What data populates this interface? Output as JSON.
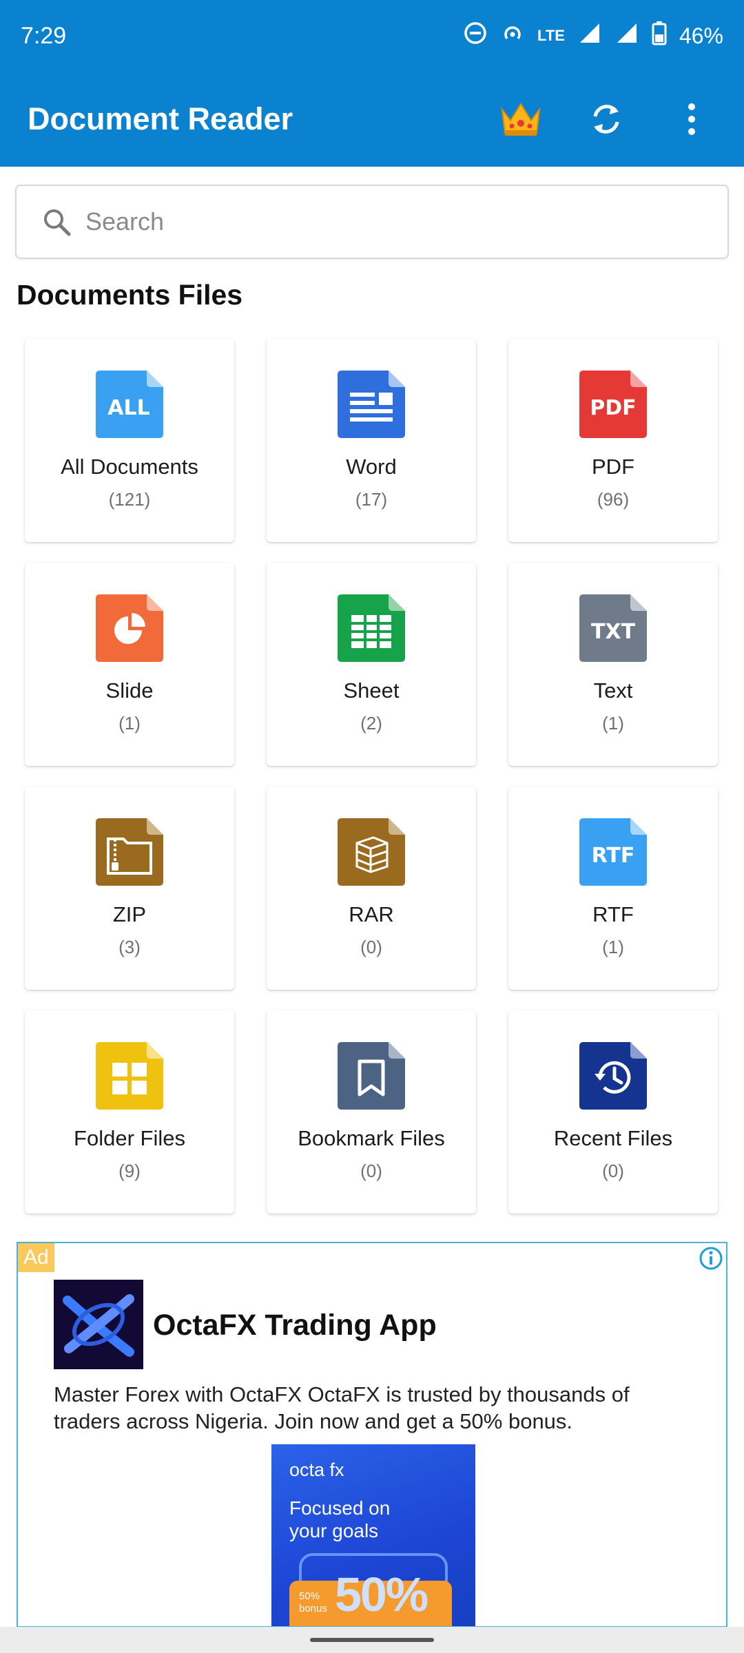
{
  "status_bar": {
    "time": "7:29",
    "network": "LTE",
    "battery": "46%"
  },
  "app_bar": {
    "title": "Document Reader",
    "icons": [
      "crown-icon",
      "sync-icon",
      "more-vertical-icon"
    ]
  },
  "search": {
    "placeholder": "Search"
  },
  "section": {
    "title": "Documents Files"
  },
  "tiles": [
    {
      "label": "All Documents",
      "count": "(121)",
      "icon_text": "ALL",
      "color": "#3aa1f2"
    },
    {
      "label": "Word",
      "count": "(17)",
      "icon": "document-lines-icon",
      "color": "#2f6fdd"
    },
    {
      "label": "PDF",
      "count": "(96)",
      "icon_text": "PDF",
      "color": "#e53935"
    },
    {
      "label": "Slide",
      "count": "(1)",
      "icon": "pie-chart-icon",
      "color": "#f26a39"
    },
    {
      "label": "Sheet",
      "count": "(2)",
      "icon": "table-grid-icon",
      "color": "#16a34a"
    },
    {
      "label": "Text",
      "count": "(1)",
      "icon_text": "TXT",
      "color": "#6f7a8a"
    },
    {
      "label": "ZIP",
      "count": "(3)",
      "icon": "zip-icon",
      "color": "#9a6b1f"
    },
    {
      "label": "RAR",
      "count": "(0)",
      "icon": "archive-box-icon",
      "color": "#9a6b1f"
    },
    {
      "label": "RTF",
      "count": "(1)",
      "icon_text": "RTF",
      "color": "#3aa1f2"
    },
    {
      "label": "Folder Files",
      "count": "(9)",
      "icon": "four-squares-icon",
      "color": "#efc20f"
    },
    {
      "label": "Bookmark Files",
      "count": "(0)",
      "icon": "bookmark-icon",
      "color": "#4d6384"
    },
    {
      "label": "Recent Files",
      "count": "(0)",
      "icon": "history-icon",
      "color": "#15348f"
    }
  ],
  "ad": {
    "badge": "Ad",
    "app_name": "OctaFX Trading App",
    "description": "Master Forex with OctaFX OctaFX is trusted by thousands of traders across Nigeria. Join now and get a 50% bonus.",
    "banner_brand": "octa fx",
    "banner_tagline": "Focused on your goals",
    "banner_bonus_label": "50% bonus",
    "banner_big": "50%"
  }
}
